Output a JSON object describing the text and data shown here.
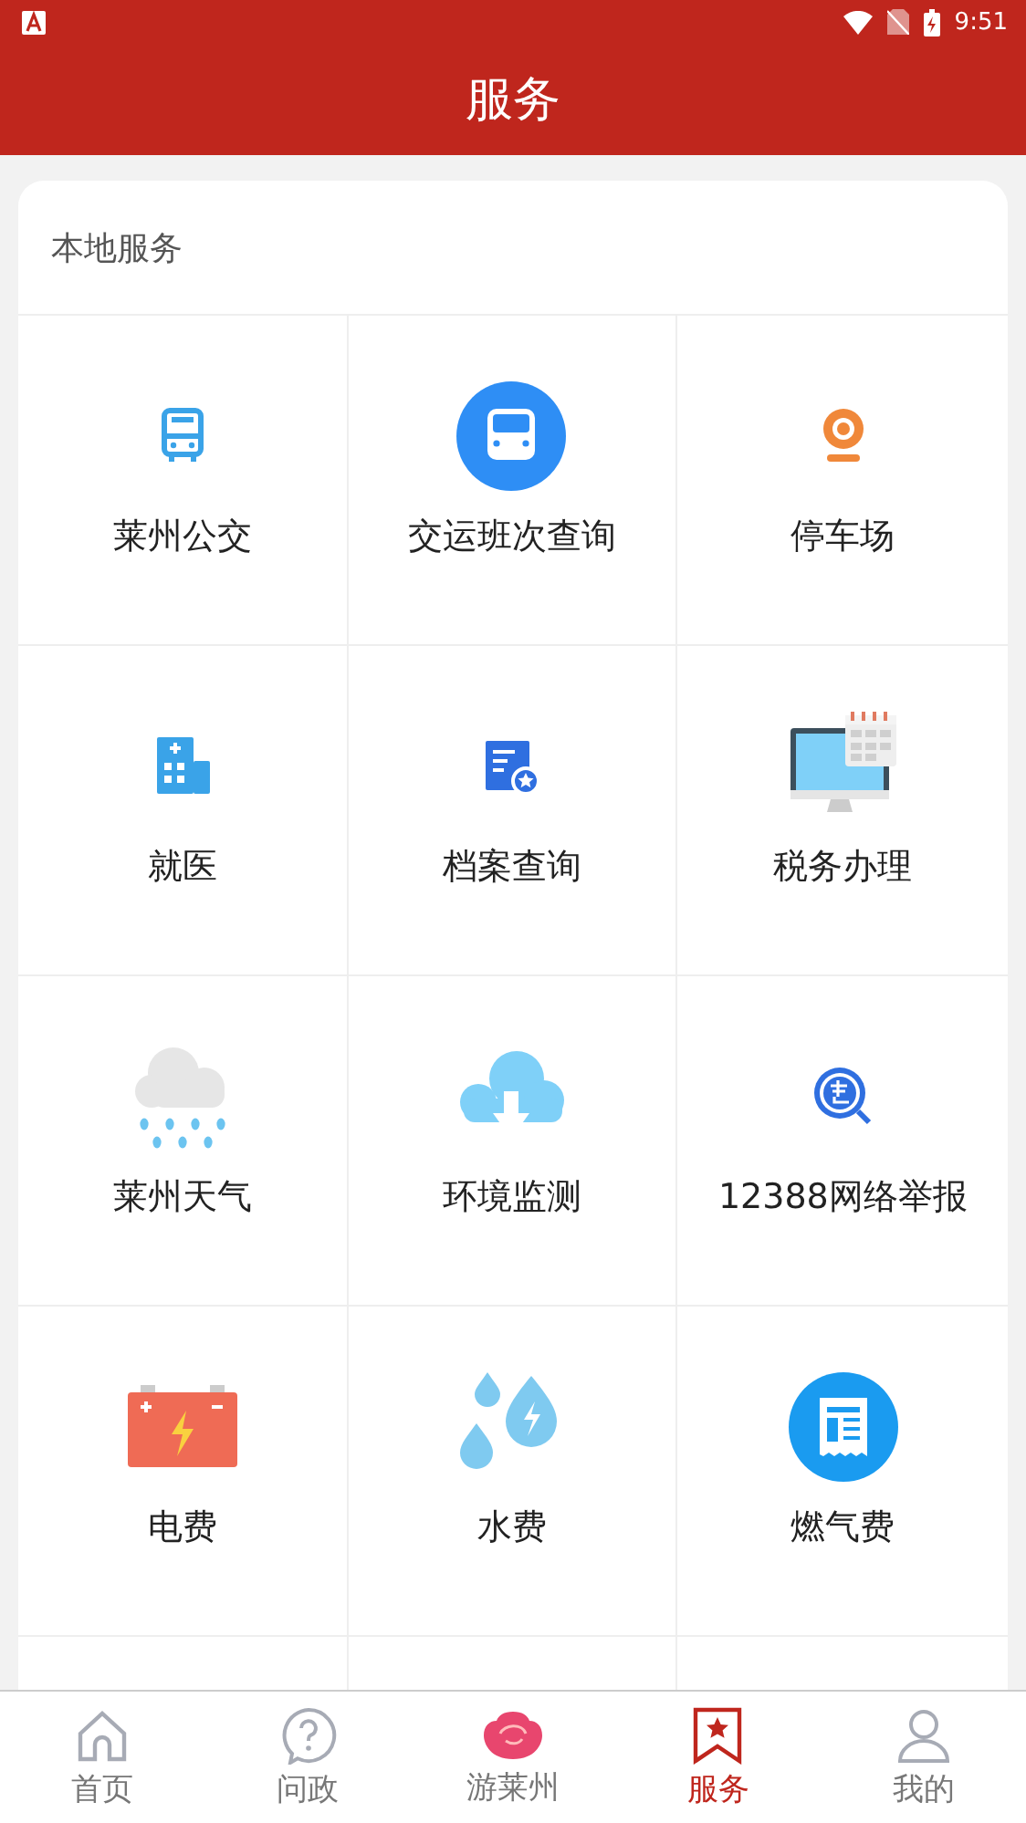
{
  "status_bar": {
    "time": "9:51"
  },
  "header": {
    "title": "服务"
  },
  "section": {
    "title": "本地服务",
    "items": [
      {
        "label": "莱州公交"
      },
      {
        "label": "交运班次查询"
      },
      {
        "label": "停车场"
      },
      {
        "label": "就医"
      },
      {
        "label": "档案查询"
      },
      {
        "label": "税务办理"
      },
      {
        "label": "莱州天气"
      },
      {
        "label": "环境监测"
      },
      {
        "label": "12388网络举报"
      },
      {
        "label": "电费"
      },
      {
        "label": "水费"
      },
      {
        "label": "燃气费"
      }
    ]
  },
  "tab_bar": [
    {
      "label": "首页",
      "selected": false
    },
    {
      "label": "问政",
      "selected": false
    },
    {
      "label": "游莱州",
      "selected": false
    },
    {
      "label": "服务",
      "selected": true
    },
    {
      "label": "我的",
      "selected": false
    }
  ]
}
